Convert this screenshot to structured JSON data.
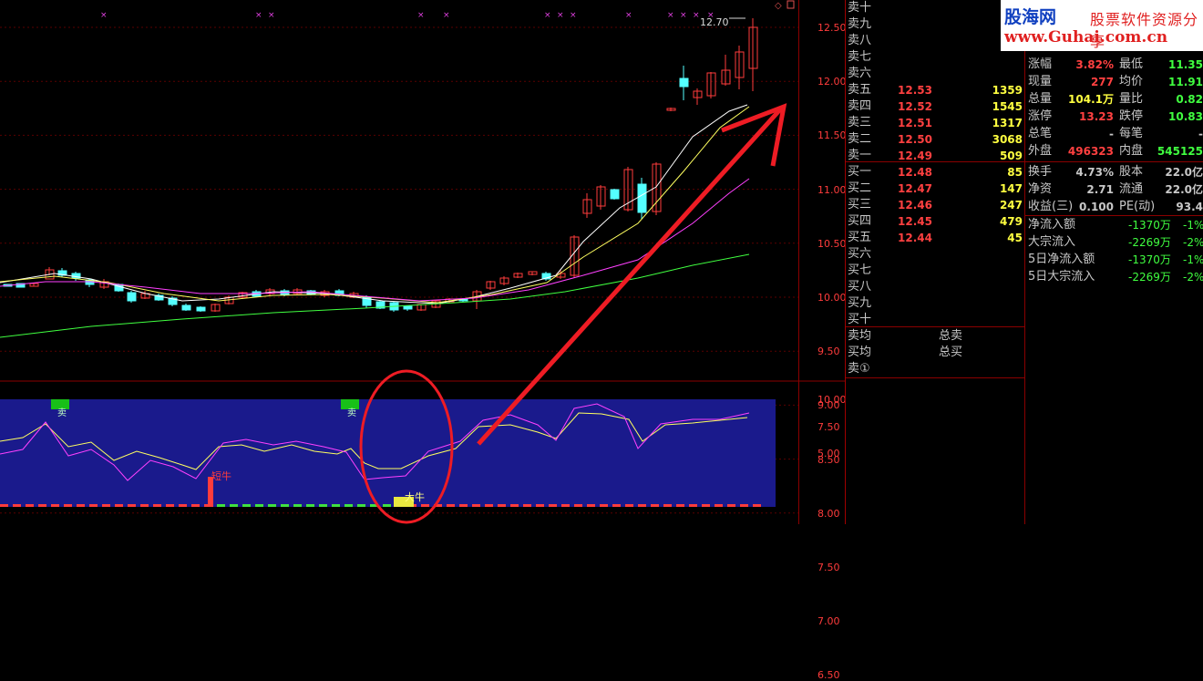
{
  "price_axis": [
    "12.50",
    "12.00",
    "11.50",
    "11.00",
    "10.50",
    "10.00",
    "9.50",
    "9.00",
    "8.50",
    "8.00",
    "7.50",
    "7.00",
    "6.50"
  ],
  "indicator_axis": [
    "10.00",
    "7.50",
    "5.00"
  ],
  "high_label": "12.70",
  "signals": {
    "sell1": "卖",
    "sell2": "卖",
    "short_bull": "短牛",
    "big_bull": "大牛"
  },
  "order_book": {
    "asks": [
      {
        "label": "卖十",
        "price": "",
        "vol": ""
      },
      {
        "label": "卖九",
        "price": "",
        "vol": ""
      },
      {
        "label": "卖八",
        "price": "",
        "vol": ""
      },
      {
        "label": "卖七",
        "price": "",
        "vol": ""
      },
      {
        "label": "卖六",
        "price": "",
        "vol": ""
      },
      {
        "label": "卖五",
        "price": "12.53",
        "vol": "1359"
      },
      {
        "label": "卖四",
        "price": "12.52",
        "vol": "1545"
      },
      {
        "label": "卖三",
        "price": "12.51",
        "vol": "1317"
      },
      {
        "label": "卖二",
        "price": "12.50",
        "vol": "3068"
      },
      {
        "label": "卖一",
        "price": "12.49",
        "vol": "509"
      }
    ],
    "bids": [
      {
        "label": "买一",
        "price": "12.48",
        "vol": "85"
      },
      {
        "label": "买二",
        "price": "12.47",
        "vol": "147"
      },
      {
        "label": "买三",
        "price": "12.46",
        "vol": "247"
      },
      {
        "label": "买四",
        "price": "12.45",
        "vol": "479"
      },
      {
        "label": "买五",
        "price": "12.44",
        "vol": "45"
      },
      {
        "label": "买六",
        "price": "",
        "vol": ""
      },
      {
        "label": "买七",
        "price": "",
        "vol": ""
      },
      {
        "label": "买八",
        "price": "",
        "vol": ""
      },
      {
        "label": "买九",
        "price": "",
        "vol": ""
      },
      {
        "label": "买十",
        "price": "",
        "vol": ""
      }
    ],
    "sell_avg": "卖均",
    "buy_avg": "买均",
    "total_sell": "总卖",
    "total_buy": "总买",
    "sell_one_circled": "卖①"
  },
  "logo": {
    "name": "股海网",
    "tagline": "股票软件资源分享",
    "url": "www.Guhai.com.cn"
  },
  "stats": [
    {
      "l1": "涨幅",
      "v1": "3.82%",
      "c1": "#ff4040",
      "l2": "最低",
      "v2": "11.35",
      "c2": "#40ff40"
    },
    {
      "l1": "现量",
      "v1": "277",
      "c1": "#ff4040",
      "l2": "均价",
      "v2": "11.91",
      "c2": "#40ff40"
    },
    {
      "l1": "总量",
      "v1": "104.1万",
      "c1": "#ffff40",
      "l2": "量比",
      "v2": "0.82",
      "c2": "#40ff40"
    },
    {
      "l1": "涨停",
      "v1": "13.23",
      "c1": "#ff4040",
      "l2": "跌停",
      "v2": "10.83",
      "c2": "#40ff40"
    },
    {
      "l1": "总笔",
      "v1": "-",
      "c1": "#c8c8c8",
      "l2": "每笔",
      "v2": "-",
      "c2": "#c8c8c8"
    },
    {
      "l1": "外盘",
      "v1": "496323",
      "c1": "#ff4040",
      "l2": "内盘",
      "v2": "545125",
      "c2": "#40ff40"
    },
    {
      "l1": "换手",
      "v1": "4.73%",
      "c1": "#c8c8c8",
      "l2": "股本",
      "v2": "22.0亿",
      "c2": "#c8c8c8"
    },
    {
      "l1": "净资",
      "v1": "2.71",
      "c1": "#c8c8c8",
      "l2": "流通",
      "v2": "22.0亿",
      "c2": "#c8c8c8"
    },
    {
      "l1": "收益(三)",
      "v1": "0.100",
      "c1": "#c8c8c8",
      "l2": "PE(动)",
      "v2": "93.4",
      "c2": "#c8c8c8"
    }
  ],
  "flows": [
    {
      "label": "净流入额",
      "value": "-1370万",
      "pct": "-1%"
    },
    {
      "label": "大宗流入",
      "value": "-2269万",
      "pct": "-2%"
    },
    {
      "label": "5日净流入额",
      "value": "-1370万",
      "pct": "-1%"
    },
    {
      "label": "5日大宗流入",
      "value": "-2269万",
      "pct": "-2%"
    }
  ],
  "colors": {
    "up": "#ff3c3c",
    "down": "#54ffff",
    "ma5": "#ffffff",
    "ma10": "#ffff60",
    "ma20": "#ff40ff",
    "ma60": "#40ff40",
    "panel": "#1a1a8c",
    "annotation": "#ee1c24"
  }
}
